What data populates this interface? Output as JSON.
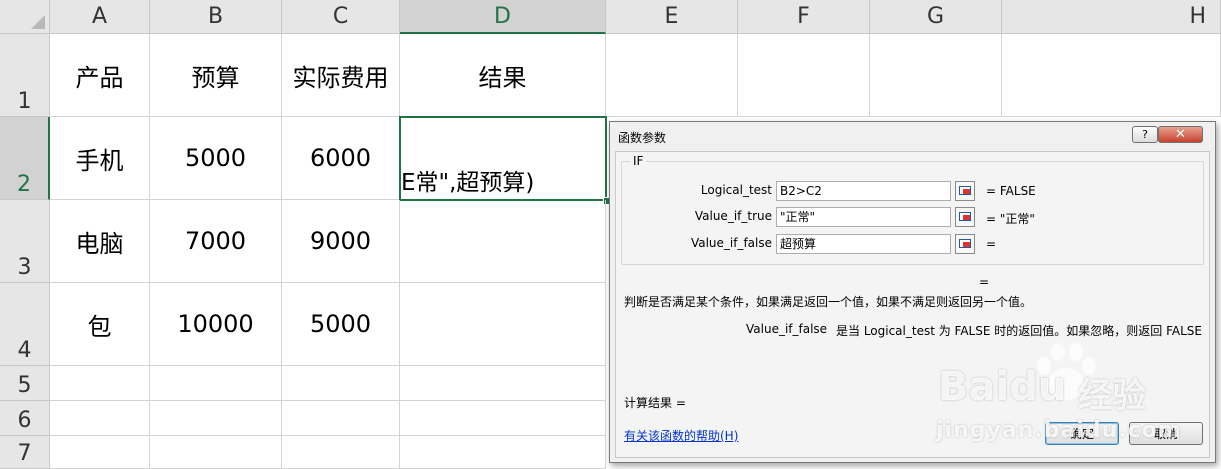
{
  "columns": [
    "A",
    "B",
    "C",
    "D",
    "E",
    "F",
    "G",
    "H"
  ],
  "rows": [
    "1",
    "2",
    "3",
    "4",
    "5",
    "6",
    "7"
  ],
  "cells": {
    "A1": "产品",
    "B1": "预算",
    "C1": "实际费用",
    "D1": "结果",
    "A2": "手机",
    "B2": "5000",
    "C2": "6000",
    "D2": "E常\",超预算)",
    "A3": "电脑",
    "B3": "7000",
    "C3": "9000",
    "A4": "包",
    "B4": "10000",
    "C4": "5000"
  },
  "dialog": {
    "title": "函数参数",
    "help_label": "?",
    "close_label": "✕",
    "function_name": "IF",
    "args": [
      {
        "label": "Logical_test",
        "value": "B2>C2",
        "result": "=  FALSE"
      },
      {
        "label": "Value_if_true",
        "value": "\"正常\"",
        "result": "=  \"正常\""
      },
      {
        "label": "Value_if_false",
        "value": "超预算",
        "result": "="
      }
    ],
    "overall_result": "=",
    "description": "判断是否满足某个条件，如果满足返回一个值，如果不满足则返回另一个值。",
    "param_help_name": "Value_if_false",
    "param_help_text": "是当 Logical_test 为 FALSE 时的返回值。如果忽略，则返回 FALSE",
    "calc_result_label": "计算结果 =",
    "help_link": "有关该函数的帮助(H)",
    "ok_label": "确定",
    "cancel_label": "取消"
  },
  "watermark": {
    "brand": "Baidu",
    "product": "经验",
    "url": "jingyan.baidu.com"
  }
}
